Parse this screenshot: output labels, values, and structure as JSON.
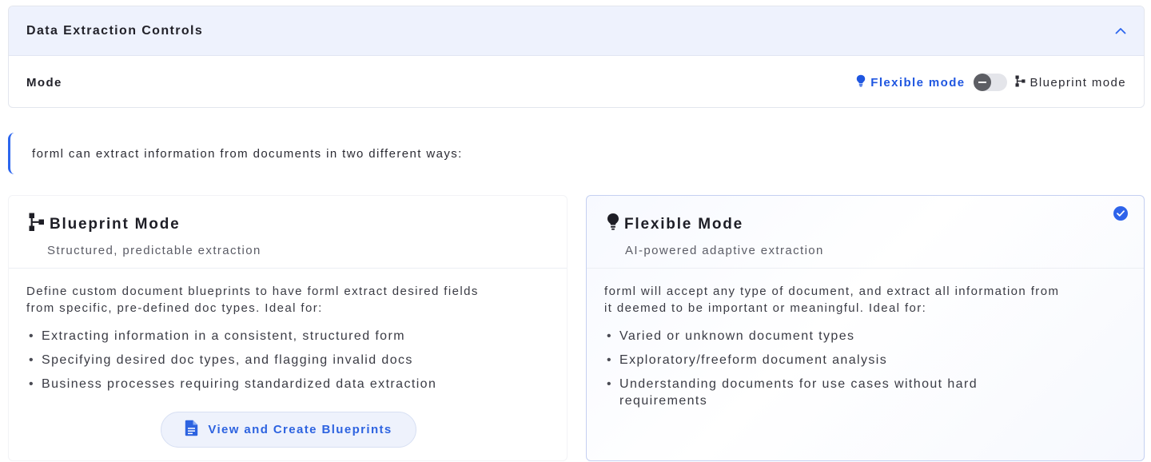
{
  "panel": {
    "title": "Data Extraction Controls",
    "mode_label": "Mode",
    "flexible_option": "Flexible mode",
    "blueprint_option": "Blueprint mode",
    "selected_mode": "flexible"
  },
  "callout": {
    "text": "forml can extract information from documents in two different ways:"
  },
  "cards": {
    "blueprint": {
      "title": "Blueprint Mode",
      "subtitle": "Structured, predictable extraction",
      "description_line1": "Define custom document blueprints to have forml extract desired fields",
      "description_line2": "from specific, pre-defined doc types. Ideal for:",
      "bullets": [
        "Extracting information in a consistent, structured form",
        "Specifying desired doc types, and flagging invalid docs",
        "Business processes requiring standardized data extraction"
      ],
      "button_label": "View and Create Blueprints",
      "selected": false
    },
    "flexible": {
      "title": "Flexible Mode",
      "subtitle": "AI-powered adaptive extraction",
      "description_line1": "forml will accept any type of document, and extract all information from",
      "description_line2": "it deemed to be important or meaningful. Ideal for:",
      "bullets": [
        "Varied or unknown document types",
        "Exploratory/freeform document analysis",
        "Understanding documents for use cases without hard requirements"
      ],
      "selected": true
    }
  },
  "icons": {
    "collapse": "chevron-up-icon",
    "flexible": "lightbulb-icon",
    "blueprint": "hierarchy-icon",
    "selected": "check-circle-icon",
    "button": "document-icon"
  },
  "colors": {
    "accent": "#1f56e0",
    "header_bg": "#eef2fd",
    "selected_border": "#c5d0f1"
  }
}
